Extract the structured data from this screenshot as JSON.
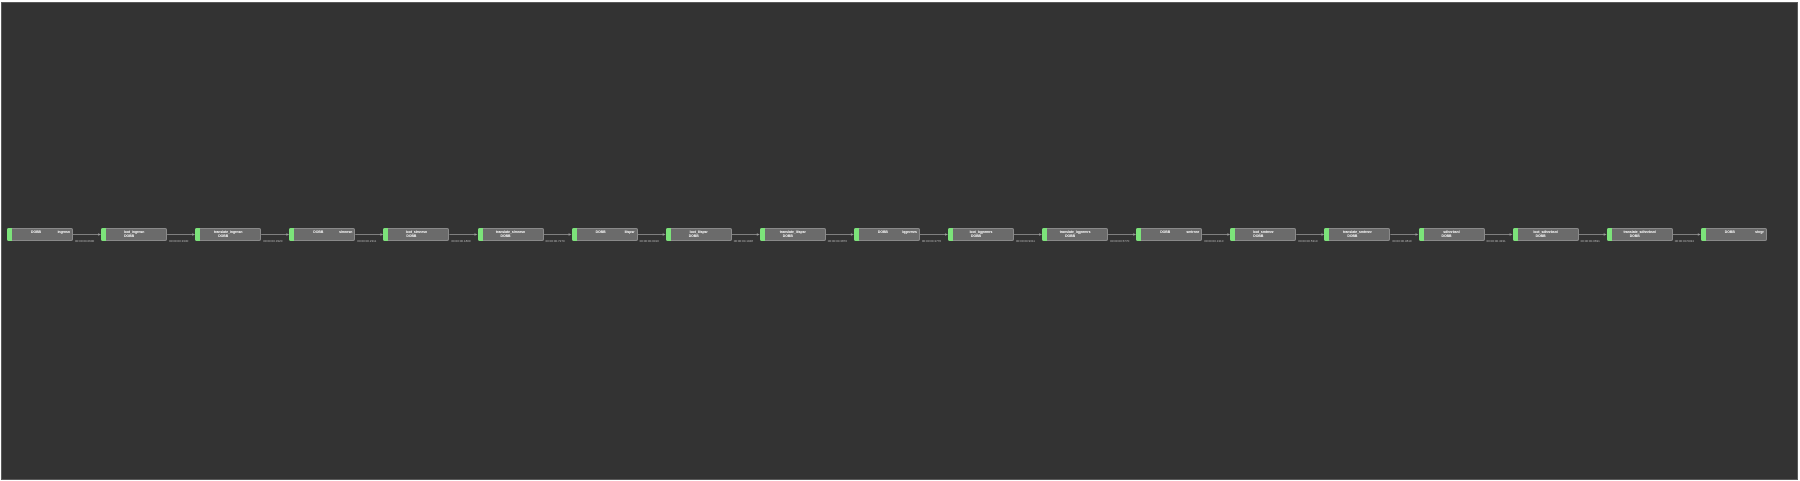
{
  "diagram": {
    "nodes": [
      {
        "name": "DOBB",
        "id": "ingrnsn",
        "type": "A"
      },
      {
        "name": "loot_ingrnsn",
        "id": "DOBB",
        "type": "B"
      },
      {
        "name": "translate_ingrnsn",
        "id": "DOBB",
        "type": "B"
      },
      {
        "name": "DOBB",
        "id": "slmnrsn",
        "type": "A"
      },
      {
        "name": "loot_slmnrsn",
        "id": "DOBB",
        "type": "B"
      },
      {
        "name": "translate_slmnrsn",
        "id": "DOBB",
        "type": "B"
      },
      {
        "name": "DOBB",
        "id": "liispsr",
        "type": "A"
      },
      {
        "name": "loot_liispsr",
        "id": "DOBB",
        "type": "B"
      },
      {
        "name": "translate_liispsr",
        "id": "DOBB",
        "type": "B"
      },
      {
        "name": "DOBB",
        "id": "lqgnrmrs",
        "type": "A"
      },
      {
        "name": "loot_lqgnrmrs",
        "id": "DOBB",
        "type": "B"
      },
      {
        "name": "translate_lqgnrmrs",
        "id": "DOBB",
        "type": "B"
      },
      {
        "name": "DOBB",
        "id": "smtrnnr",
        "type": "A"
      },
      {
        "name": "loot_smtrnnr",
        "id": "DOBB",
        "type": "B"
      },
      {
        "name": "translate_smtrnnr",
        "id": "DOBB",
        "type": "B"
      },
      {
        "name": "sdhnrbsnl",
        "id": "DOBB",
        "type": "B"
      },
      {
        "name": "loot_sdhnrbsnl",
        "id": "DOBB",
        "type": "B"
      },
      {
        "name": "translate_sdhnrbsnl",
        "id": "DOBB",
        "type": "B"
      },
      {
        "name": "DOBB",
        "id": "shrgr",
        "type": "A"
      }
    ],
    "edge_labels": [
      "00:00:00.0600",
      "00:00:00.3330",
      "00:00:00.3320",
      "00:00:00.2311",
      "00:00:00.1800",
      "00:00:00.7270",
      "00:00:00.0010",
      "00:00:00.1048",
      "00:00:00.3870",
      "00:00:00.3770",
      "00:00:00.9311",
      "00:00:00.5770",
      "00:00:00.1310",
      "00:00:00.5310",
      "00:00:00.3810",
      "00:00:00.4331",
      "00:00:00.0691",
      "00:00:00.5434"
    ],
    "colors": {
      "background": "#333333",
      "node_fill": "#6b6b6b",
      "node_status": "#7CE37A",
      "edge": "#9a9a9a",
      "label": "#b8b8b8"
    }
  }
}
